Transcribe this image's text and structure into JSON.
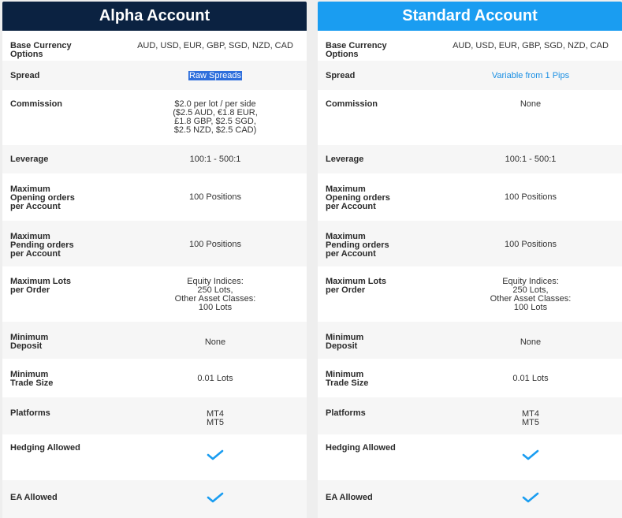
{
  "cards": [
    {
      "title": "Alpha Account",
      "rows": [
        {
          "label": "Base Currency Options",
          "value": "AUD, USD, EUR, GBP, SGD, NZD, CAD"
        },
        {
          "label": "Spread",
          "value": "Raw Spreads"
        },
        {
          "label": "Commission",
          "value": "$2.0 per lot / per side\n($2.5 AUD, €1.8 EUR,\n£1.8 GBP, $2.5 SGD,\n$2.5 NZD, $2.5 CAD)"
        },
        {
          "label": "Leverage",
          "value": "100:1 - 500:1"
        },
        {
          "label": "Maximum\nOpening orders\nper Account",
          "value": "100 Positions"
        },
        {
          "label": "Maximum\nPending orders\nper Account",
          "value": "100 Positions"
        },
        {
          "label": "Maximum Lots\nper Order",
          "value": "Equity Indices:\n250 Lots,\nOther Asset Classes:\n100 Lots"
        },
        {
          "label": "Minimum\nDeposit",
          "value": "None"
        },
        {
          "label": "Minimum\nTrade Size",
          "value": "0.01 Lots"
        },
        {
          "label": "Platforms",
          "value": "MT4\nMT5"
        },
        {
          "label": "Hedging Allowed",
          "value": "check-icon"
        },
        {
          "label": "EA Allowed",
          "value": "check-icon"
        }
      ]
    },
    {
      "title": "Standard Account",
      "rows": [
        {
          "label": "Base Currency Options",
          "value": "AUD, USD, EUR, GBP, SGD, NZD, CAD"
        },
        {
          "label": "Spread",
          "value": "Variable from 1 Pips"
        },
        {
          "label": "Commission",
          "value": "None"
        },
        {
          "label": "Leverage",
          "value": "100:1 - 500:1"
        },
        {
          "label": "Maximum\nOpening orders\nper Account",
          "value": "100 Positions"
        },
        {
          "label": "Maximum\nPending orders\nper Account",
          "value": "100 Positions"
        },
        {
          "label": "Maximum Lots\nper Order",
          "value": "Equity Indices:\n250 Lots,\nOther Asset Classes:\n100 Lots"
        },
        {
          "label": "Minimum\nDeposit",
          "value": "None"
        },
        {
          "label": "Minimum\nTrade Size",
          "value": "0.01 Lots"
        },
        {
          "label": "Platforms",
          "value": "MT4\nMT5"
        },
        {
          "label": "Hedging Allowed",
          "value": "check-icon"
        },
        {
          "label": "EA Allowed",
          "value": "check-icon"
        }
      ]
    }
  ],
  "colors": {
    "alpha_header": "#0b2241",
    "standard_header": "#1a9df1",
    "check": "#1a9df1",
    "link": "#1a8fe3"
  }
}
